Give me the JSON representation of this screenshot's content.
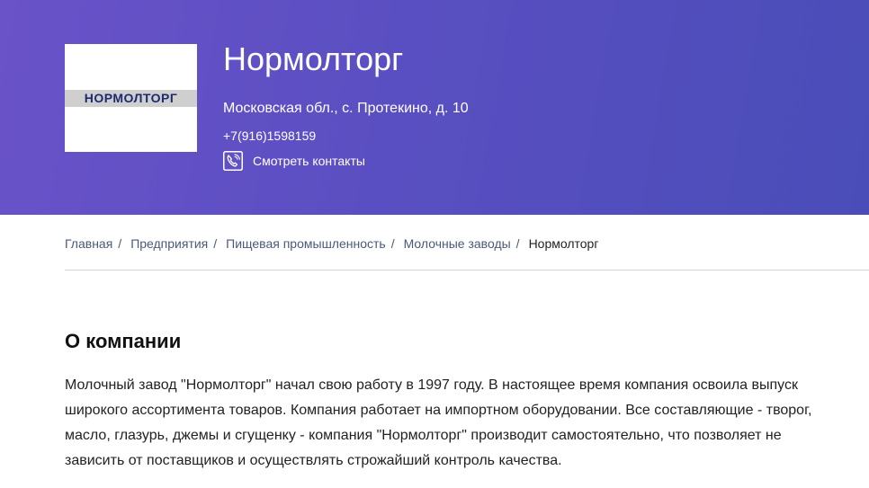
{
  "header": {
    "logo_text": "НОРМОЛТОРГ",
    "company_name": "Нормолторг",
    "address": "Московская обл., с. Протекино, д. 10",
    "phone": "+7(916)1598159",
    "contacts_label": "Смотреть контакты",
    "contacts_icon": "phone-icon",
    "gradient_start": "#6a52c9",
    "gradient_end": "#4a4db8"
  },
  "breadcrumb": {
    "items": [
      {
        "label": "Главная"
      },
      {
        "label": "Предприятия"
      },
      {
        "label": "Пищевая промышленность"
      },
      {
        "label": "Молочные заводы"
      }
    ],
    "separator": "/",
    "current": "Нормолторг"
  },
  "about": {
    "title": "О компании",
    "text": "Молочный завод \"Нормолторг\" начал свою работу в 1997 году. В настоящее время компания освоила выпуск широкого ассортимента товаров. Компания работает на импортном оборудовании. Все составляющие - творог, масло, глазурь, джемы и сгущенку - компания \"Нормолторг\" производит самостоятельно, что позволяет не зависить от поставщиков и осуществлять строжайший контроль качества."
  }
}
